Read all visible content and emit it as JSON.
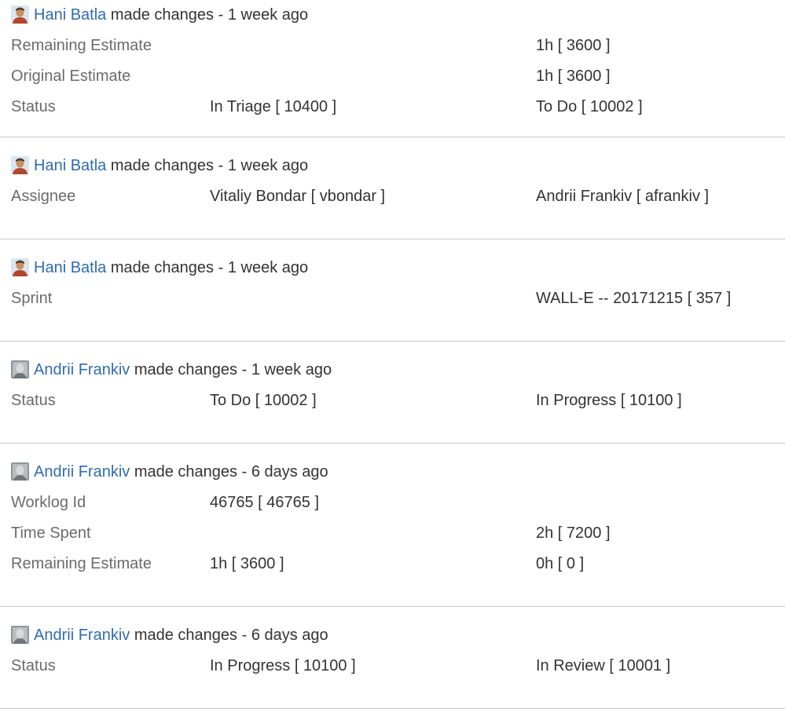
{
  "history": [
    {
      "author": "Hani Batla",
      "avatar_icon": "hani-avatar-icon",
      "action": "made changes",
      "time": "1 week ago",
      "changes": [
        {
          "field": "Remaining Estimate",
          "old": "",
          "new": "1h [ 3600 ]"
        },
        {
          "field": "Original Estimate",
          "old": "",
          "new": "1h [ 3600 ]"
        },
        {
          "field": "Status",
          "old": "In Triage [ 10400 ]",
          "new": "To Do [ 10002 ]"
        }
      ]
    },
    {
      "author": "Hani Batla",
      "avatar_icon": "hani-avatar-icon",
      "action": "made changes",
      "time": "1 week ago",
      "changes": [
        {
          "field": "Assignee",
          "old": "Vitaliy Bondar [ vbondar ]",
          "new": "Andrii Frankiv [ afrankiv ]"
        }
      ]
    },
    {
      "author": "Hani Batla",
      "avatar_icon": "hani-avatar-icon",
      "action": "made changes",
      "time": "1 week ago",
      "changes": [
        {
          "field": "Sprint",
          "old": "",
          "new": "WALL-E -- 20171215 [ 357 ]"
        }
      ]
    },
    {
      "author": "Andrii Frankiv",
      "avatar_icon": "andrii-avatar-icon",
      "action": "made changes",
      "time": "1 week ago",
      "changes": [
        {
          "field": "Status",
          "old": "To Do [ 10002 ]",
          "new": "In Progress [ 10100 ]"
        }
      ]
    },
    {
      "author": "Andrii Frankiv",
      "avatar_icon": "andrii-avatar-icon",
      "action": "made changes",
      "time": "6 days ago",
      "changes": [
        {
          "field": "Worklog Id",
          "old": "46765 [ 46765 ]",
          "new": ""
        },
        {
          "field": "Time Spent",
          "old": "",
          "new": "2h [ 7200 ]"
        },
        {
          "field": "Remaining Estimate",
          "old": "1h [ 3600 ]",
          "new": "0h [ 0 ]"
        }
      ]
    },
    {
      "author": "Andrii Frankiv",
      "avatar_icon": "andrii-avatar-icon",
      "action": "made changes",
      "time": "6 days ago",
      "changes": [
        {
          "field": "Status",
          "old": "In Progress [ 10100 ]",
          "new": "In Review [ 10001 ]"
        }
      ]
    }
  ],
  "colors": {
    "link": "#2f6bb3",
    "field_label": "#6b6b6b",
    "value_text": "#333333",
    "divider": "#c7c7c7"
  }
}
